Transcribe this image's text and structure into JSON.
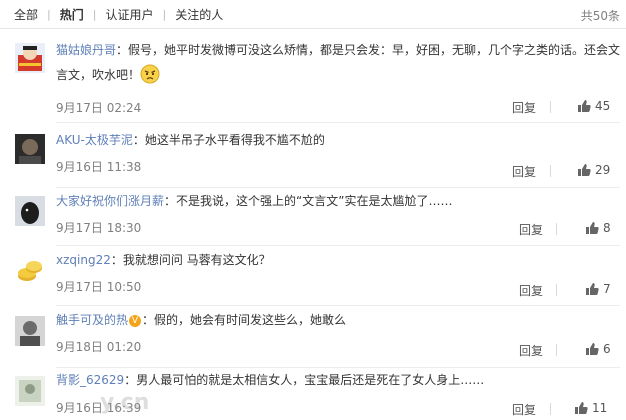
{
  "tabs": [
    {
      "label": "全部"
    },
    {
      "label": "热门"
    },
    {
      "label": "认证用户"
    },
    {
      "label": "关注的人"
    }
  ],
  "total_count": "共50条",
  "reply_label": "回复",
  "comments": [
    {
      "user": "猫姑娘丹哥",
      "colon": "：",
      "text": "假号，她平时发微博可没这么矫情，都是只会发：早，好困，无聊，几个字之类的话。还会文言文，吹水吧！",
      "time": "9月17日 02:24",
      "likes": "45"
    },
    {
      "user": "AKU-太极芋泥",
      "colon": "：",
      "text": "她这半吊子水平看得我不尴不尬的",
      "time": "9月16日 11:38",
      "likes": "29"
    },
    {
      "user": "大家好祝你们涨月薪",
      "colon": "：",
      "text": "不是我说，这个强上的“文言文”实在是太尴尬了……",
      "time": "9月17日 18:30",
      "likes": "8"
    },
    {
      "user": "xzqing22",
      "colon": "：",
      "text": "我就想问问 马蓉有这文化？",
      "time": "9月17日 10:50",
      "likes": "7"
    },
    {
      "user": "触手可及的热",
      "colon": "：",
      "text": "假的，她会有时间发这些么，她敢么",
      "time": "9月18日 01:20",
      "likes": "6"
    },
    {
      "user": "背影_62629",
      "colon": "：",
      "text": "男人最可怕的就是太相信女人，宝宝最后还是死在了女人身上……",
      "time": "9月16日 16:39",
      "likes": "11"
    }
  ],
  "verified_badge": "V",
  "watermark_text": "y.cn",
  "colors": {
    "username": "#eb7350",
    "username_alt": "#5e7fb7",
    "meta": "#808080",
    "badge": "#f2a41b"
  }
}
